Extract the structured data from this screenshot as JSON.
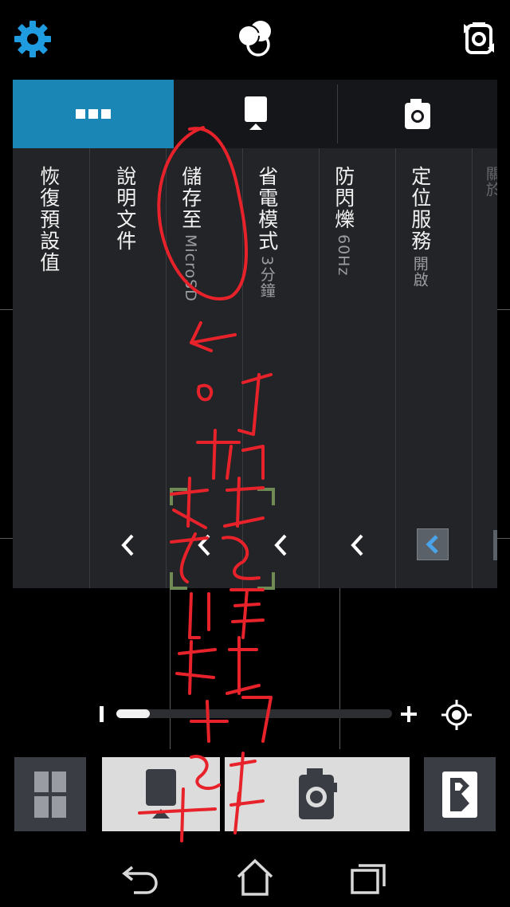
{
  "colors": {
    "accent": "#1a86b5",
    "settings_icon": "#1f9be0",
    "panel_bg": "#232427",
    "tab_bg": "#151619",
    "annotation": "#e8222a",
    "chevron_highlight": "#4aa3e8"
  },
  "top_bar": {
    "settings_icon": "gear-icon",
    "mode_icon": "overlapping-circles-icon",
    "switch_camera_icon": "camera-rotate-icon"
  },
  "panel": {
    "tabs": [
      {
        "icon": "more-dots-icon",
        "active": true
      },
      {
        "icon": "video-camera-icon",
        "active": false
      },
      {
        "icon": "photo-camera-icon",
        "active": false
      }
    ],
    "items": [
      {
        "label": "恢復預設值",
        "value": ""
      },
      {
        "label": "說明文件",
        "value": ""
      },
      {
        "label": "儲存至",
        "value": "MicroSD"
      },
      {
        "label": "省電模式",
        "value": "3分鐘"
      },
      {
        "label": "防閃爍",
        "value": "60Hz"
      },
      {
        "label": "定位服務",
        "value": "開啟"
      },
      {
        "label": "關於",
        "value": ""
      }
    ]
  },
  "zoom": {
    "level": 0.12
  },
  "bottom_controls": {
    "gallery_icon": "grid-icon",
    "video_icon": "video-camera-icon",
    "shutter_icon": "photo-camera-icon",
    "app_icon": "b-logo-icon"
  },
  "nav": {
    "back_icon": "back-arrow-icon",
    "home_icon": "home-icon",
    "recents_icon": "recent-apps-icon"
  }
}
